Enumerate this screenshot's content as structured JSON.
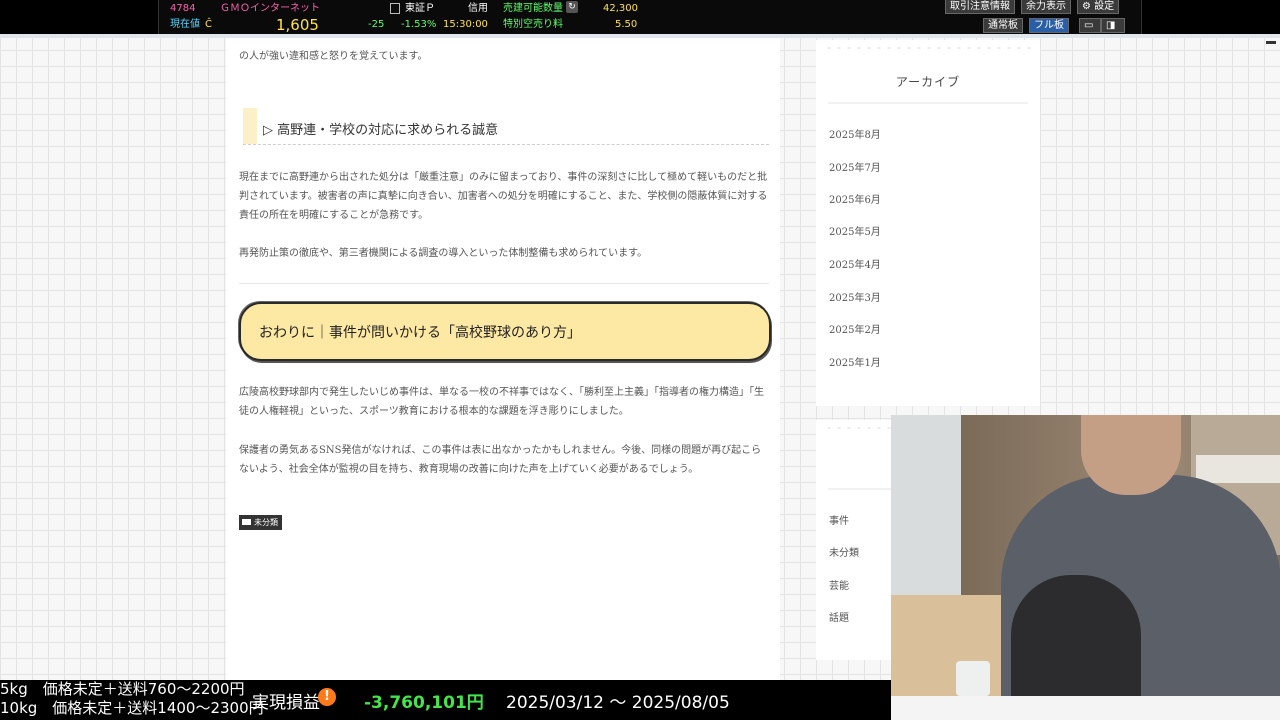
{
  "ticker": {
    "code": "4784",
    "name": "ＧＭＯインターネット",
    "market": "東証Ｐ",
    "margin": "信用",
    "sellable_label": "売建可能数量",
    "sellable_value": "42,300",
    "price_label": "現在値",
    "price_arrow": "Ĉ",
    "price": "1,605",
    "change": "-25",
    "change_pct": "-1.53%",
    "time": "15:30:00",
    "special_fee_label": "特別空売り料",
    "special_fee_value": "5.50",
    "buttons": [
      "取引注意情報",
      "余力表示",
      "設定"
    ],
    "modes": [
      "通常板",
      "フル板"
    ]
  },
  "article": {
    "intro_text": "の人が強い違和感と怒りを覚えています。",
    "h3": "▷ 高野連・学校の対応に求められる誠意",
    "p1": "現在までに高野連から出された処分は「厳重注意」のみに留まっており、事件の深刻さに比して極めて軽いものだと批判されています。被害者の声に真摯に向き合い、加害者への処分を明確にすること、また、学校側の隠蔽体質に対する責任の所在を明確にすることが急務です。",
    "p2": "再発防止策の徹底や、第三者機関による調査の導入といった体制整備も求められています。",
    "h2": "おわりに｜事件が問いかける「高校野球のあり方」",
    "p3": "広陵高校野球部内で発生したいじめ事件は、単なる一校の不祥事ではなく、「勝利至上主義」「指導者の権力構造」「生徒の人権軽視」といった、スポーツ教育における根本的な課題を浮き彫りにしました。",
    "p4": "保護者の勇気あるSNS発信がなければ、この事件は表に出なかったかもしれません。今後、同様の問題が再び起こらないよう、社会全体が監視の目を持ち、教育現場の改善に向けた声を上げていく必要があるでしょう。",
    "tag": "未分類"
  },
  "sidebar": {
    "archive_title": "アーカイブ",
    "archive": [
      "2025年8月",
      "2025年7月",
      "2025年6月",
      "2025年5月",
      "2025年4月",
      "2025年3月",
      "2025年2月",
      "2025年1月"
    ],
    "categories": [
      "事件",
      "未分類",
      "芸能",
      "話題"
    ]
  },
  "overlay": {
    "line1": "5kg　価格未定＋送料760～2200円",
    "line2": "10kg　価格未定＋送料1400～2300円",
    "pnl_label": "実現損益",
    "pnl_value": "-3,760,101円",
    "date_range": "2025/03/12 ～ 2025/08/05"
  },
  "colors": {
    "pnl_negative": "#44e44a",
    "heading_highlight": "#fde9a4",
    "ticker_price": "#ffe14a"
  }
}
